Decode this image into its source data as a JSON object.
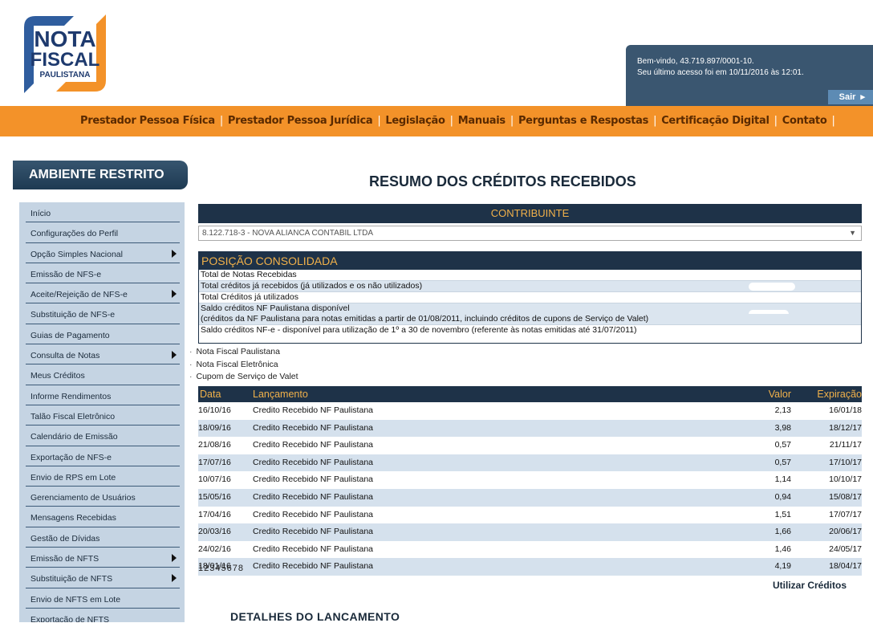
{
  "logo": {
    "line1": "NOTA",
    "line2": "FISCAL",
    "line3": "PAULISTANA"
  },
  "welcome": {
    "line1": "Bem-vindo, 43.719.897/0001-10.",
    "line2": "Seu último acesso foi em 10/11/2016 às 12:01.",
    "logout": "Sair"
  },
  "nav": [
    "Prestador Pessoa Física",
    "Prestador Pessoa Jurídica",
    "Legislação",
    "Manuais",
    "Perguntas e Respostas",
    "Certificação Digital",
    "Contato"
  ],
  "sidebar": {
    "title": "AMBIENTE RESTRITO",
    "items": [
      {
        "label": "Início",
        "sub": false
      },
      {
        "label": "Configurações do Perfil",
        "sub": false
      },
      {
        "label": "Opção Simples Nacional",
        "sub": true
      },
      {
        "label": "Emissão de NFS-e",
        "sub": false
      },
      {
        "label": "Aceite/Rejeição de NFS-e",
        "sub": true
      },
      {
        "label": "Substituição de NFS-e",
        "sub": false
      },
      {
        "label": "Guias de Pagamento",
        "sub": false
      },
      {
        "label": "Consulta de Notas",
        "sub": true
      },
      {
        "label": "Meus Créditos",
        "sub": false
      },
      {
        "label": "Informe Rendimentos",
        "sub": false
      },
      {
        "label": "Talão Fiscal Eletrônico",
        "sub": false
      },
      {
        "label": "Calendário de Emissão",
        "sub": false
      },
      {
        "label": "Exportação de NFS-e",
        "sub": false
      },
      {
        "label": "Envio de RPS em Lote",
        "sub": false
      },
      {
        "label": "Gerenciamento de Usuários",
        "sub": false
      },
      {
        "label": "Mensagens Recebidas",
        "sub": false
      },
      {
        "label": "Gestão de Dívidas",
        "sub": false
      },
      {
        "label": "Emissão de NFTS",
        "sub": true
      },
      {
        "label": "Substituição de NFTS",
        "sub": true
      },
      {
        "label": "Envio de NFTS em Lote",
        "sub": false
      },
      {
        "label": "Exportação de NFTS",
        "sub": false
      }
    ]
  },
  "main": {
    "title": "RESUMO DOS CRÉDITOS RECEBIDOS",
    "contribuinte_label": "CONTRIBUINTE",
    "contribuinte_value": "8.122.718-3 - NOVA ALIANCA CONTABIL LTDA",
    "posicao_label": "POSIÇÃO CONSOLIDADA",
    "posicao_rows": [
      "Total de Notas Recebidas",
      "Total créditos já recebidos (já utilizados e os não utilizados)",
      "Total Créditos já utilizados",
      "Saldo créditos NF Paulistana disponível",
      "(créditos da NF Paulistana para notas emitidas a partir de 01/08/2011, incluindo créditos de cupons de Serviço de Valet)",
      "Saldo créditos NF-e - disponível para utilização de 1º a 30 de novembro (referente às notas emitidas até 31/07/2011)"
    ],
    "bullets": [
      "Nota Fiscal Paulistana",
      "Nota Fiscal Eletrônica",
      "Cupom de Serviço de Valet"
    ],
    "table_headers": {
      "data": "Data",
      "lancamento": "Lançamento",
      "valor": "Valor",
      "expiracao": "Expiração"
    },
    "rows": [
      {
        "data": "16/10/16",
        "lanc": "Credito Recebido NF Paulistana",
        "valor": "2,13",
        "exp": "16/01/18"
      },
      {
        "data": "18/09/16",
        "lanc": "Credito Recebido NF Paulistana",
        "valor": "3,98",
        "exp": "18/12/17"
      },
      {
        "data": "21/08/16",
        "lanc": "Credito Recebido NF Paulistana",
        "valor": "0,57",
        "exp": "21/11/17"
      },
      {
        "data": "17/07/16",
        "lanc": "Credito Recebido NF Paulistana",
        "valor": "0,57",
        "exp": "17/10/17"
      },
      {
        "data": "10/07/16",
        "lanc": "Credito Recebido NF Paulistana",
        "valor": "1,14",
        "exp": "10/10/17"
      },
      {
        "data": "15/05/16",
        "lanc": "Credito Recebido NF Paulistana",
        "valor": "0,94",
        "exp": "15/08/17"
      },
      {
        "data": "17/04/16",
        "lanc": "Credito Recebido NF Paulistana",
        "valor": "1,51",
        "exp": "17/07/17"
      },
      {
        "data": "20/03/16",
        "lanc": "Credito Recebido NF Paulistana",
        "valor": "1,66",
        "exp": "20/06/17"
      },
      {
        "data": "24/02/16",
        "lanc": "Credito Recebido NF Paulistana",
        "valor": "1,46",
        "exp": "24/05/17"
      },
      {
        "data": "18/01/16",
        "lanc": "Credito Recebido NF Paulistana",
        "valor": "4,19",
        "exp": "18/04/17"
      }
    ],
    "pages": "12345678",
    "use_credits": "Utilizar Créditos",
    "details_title": "DETALHES DO LANCAMENTO"
  },
  "colors": {
    "nav_orange": "#f39229",
    "dark_blue": "#1e3248",
    "header_gold": "#f1b14a",
    "sidebar_bg": "#c5d4e3"
  }
}
